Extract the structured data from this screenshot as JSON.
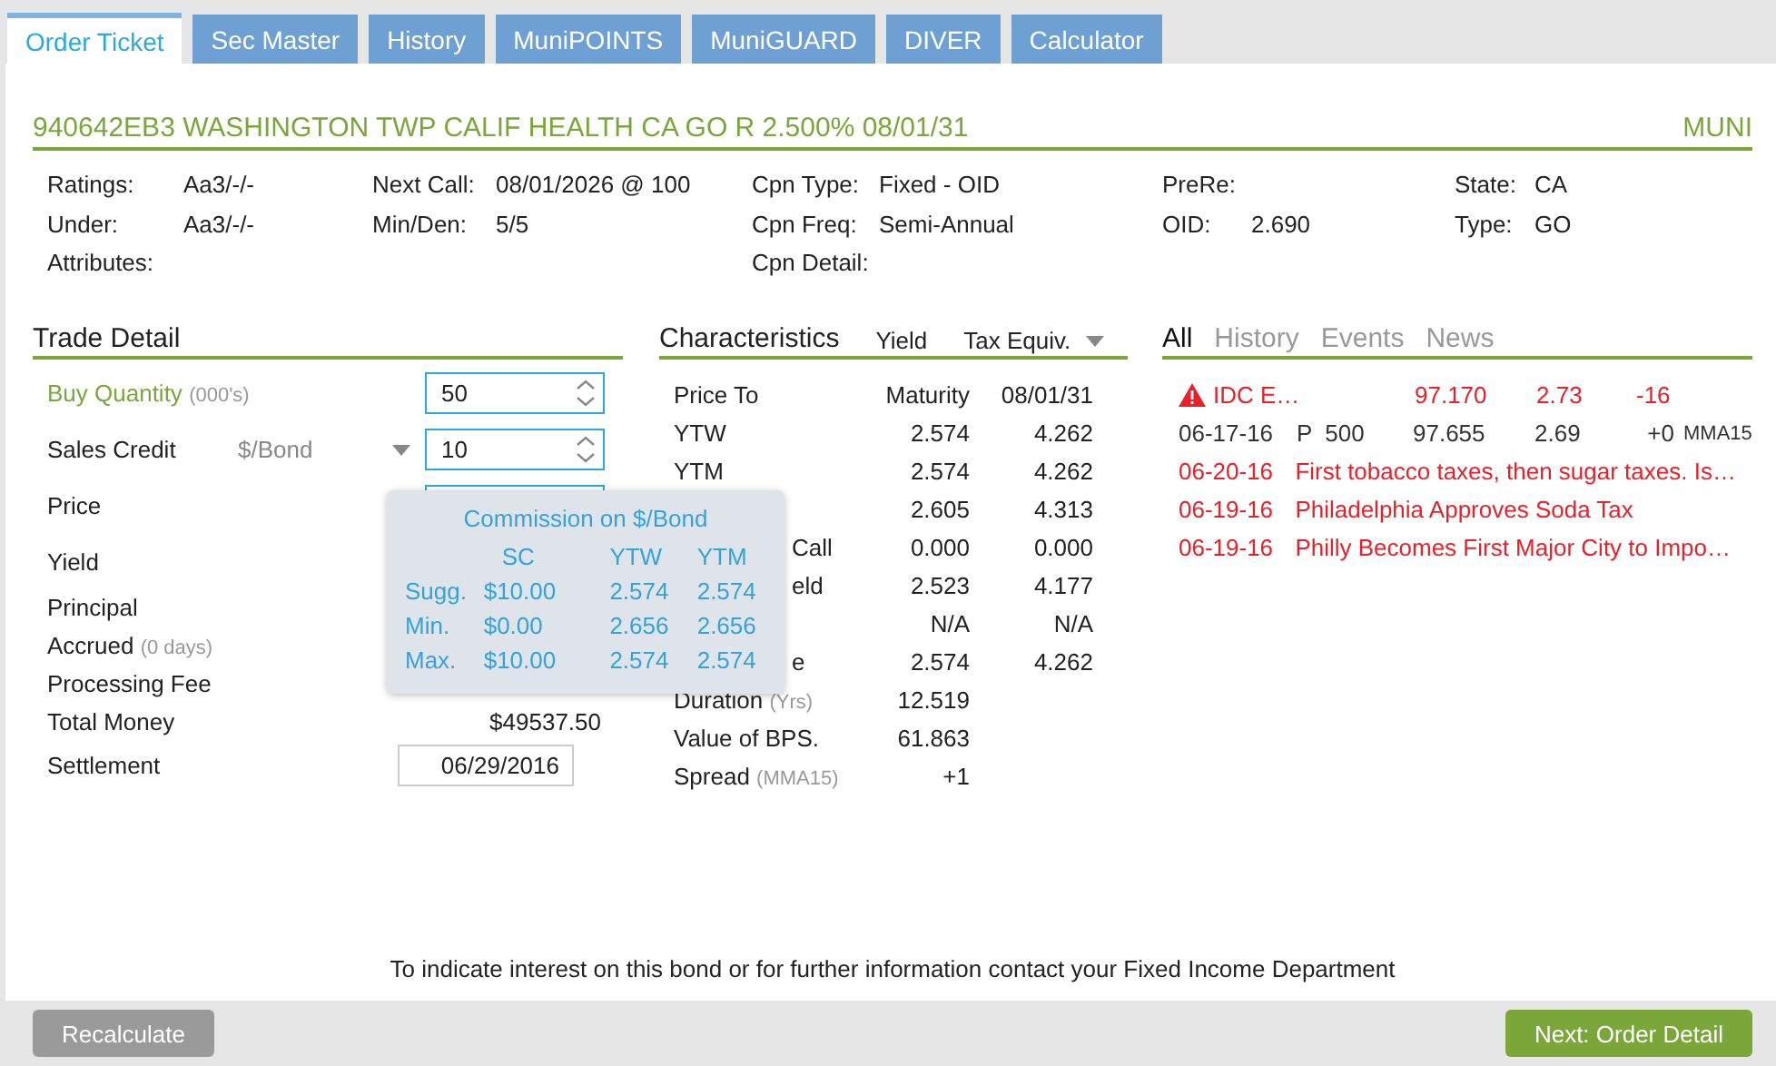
{
  "tabs": [
    {
      "label": "Order Ticket",
      "selected": true
    },
    {
      "label": "Sec Master",
      "selected": false
    },
    {
      "label": "History",
      "selected": false
    },
    {
      "label": "MuniPOINTS",
      "selected": false
    },
    {
      "label": "MuniGUARD",
      "selected": false
    },
    {
      "label": "DIVER",
      "selected": false
    },
    {
      "label": "Calculator",
      "selected": false
    }
  ],
  "security": {
    "title": "940642EB3 WASHINGTON TWP CALIF HEALTH CA GO R 2.500% 08/01/31",
    "type": "MUNI"
  },
  "info": [
    [
      {
        "label": "Ratings:",
        "value": "Aa3/-/-"
      },
      {
        "label": "Under:",
        "value": "Aa3/-/-"
      },
      {
        "label": "Attributes:"
      }
    ],
    [
      {
        "label": "Next Call:",
        "value": "08/01/2026 @ 100"
      },
      {
        "label": "Min/Den:",
        "value": "5/5"
      }
    ],
    [
      {
        "label": "Cpn Type:",
        "value": "Fixed - OID"
      },
      {
        "label": "Cpn Freq:",
        "value": "Semi-Annual"
      },
      {
        "label": "Cpn Detail:"
      }
    ],
    [
      {
        "label": "PreRe:"
      },
      {
        "label": "OID:",
        "value": "2.690"
      }
    ],
    [
      {
        "label": "State:",
        "value": "CA"
      },
      {
        "label": "Type:",
        "value": "GO"
      }
    ]
  ],
  "trade_detail": {
    "title": "Trade Detail",
    "rows": [
      {
        "kind": "spin",
        "label": "Buy Quantity",
        "note": "(000's)",
        "value": "50",
        "active": true
      },
      {
        "kind": "spin",
        "label": "Sales Credit",
        "unit": "$/Bond",
        "value": "10",
        "active": false
      },
      {
        "kind": "field",
        "label": "Price"
      },
      {
        "kind": "tall",
        "label": "Yield"
      },
      {
        "kind": "text",
        "label": "Principal"
      },
      {
        "kind": "text",
        "label": "Accrued",
        "note": "(0 days)"
      },
      {
        "kind": "text",
        "label": "Processing Fee"
      },
      {
        "kind": "text",
        "label": "Total Money",
        "value": "$49537.50"
      },
      {
        "kind": "date",
        "label": "Settlement",
        "value": "06/29/2016"
      }
    ]
  },
  "commission_popup": {
    "title": "Commission on $/Bond",
    "columns": [
      "SC",
      "YTW",
      "YTM"
    ],
    "rows": [
      {
        "label": "Sugg.",
        "values": [
          "$10.00",
          "2.574",
          "2.574"
        ]
      },
      {
        "label": "Min.",
        "values": [
          "$0.00",
          "2.656",
          "2.656"
        ]
      },
      {
        "label": "Max.",
        "values": [
          "$10.00",
          "2.574",
          "2.574"
        ]
      }
    ]
  },
  "characteristics": {
    "title": "Characteristics",
    "column_1": "Yield",
    "column_2": "Tax Equiv.",
    "rows": [
      {
        "kind": "plain",
        "label": "Price To",
        "values": [
          "Maturity",
          "08/01/31"
        ]
      },
      {
        "kind": "plain",
        "label": "YTW",
        "values": [
          "2.574",
          "4.262"
        ]
      },
      {
        "kind": "plain",
        "label": "YTM",
        "values": [
          "2.574",
          "4.262"
        ]
      },
      {
        "kind": "covered",
        "values": [
          "2.605",
          "4.313"
        ]
      },
      {
        "kind": "covered",
        "label": "Call",
        "values": [
          "0.000",
          "0.000"
        ]
      },
      {
        "kind": "covered",
        "label": "eld",
        "values": [
          "2.523",
          "4.177"
        ]
      },
      {
        "kind": "covered",
        "values": [
          "N/A",
          "N/A"
        ]
      },
      {
        "kind": "covered",
        "label": "e",
        "values": [
          "2.574",
          "4.262"
        ]
      },
      {
        "kind": "plain",
        "label": "Duration",
        "note": "(Yrs)",
        "values": [
          "12.519"
        ]
      },
      {
        "kind": "plain",
        "label": "Value of BPS.",
        "values": [
          "61.863"
        ]
      },
      {
        "kind": "plain",
        "label": "Spread",
        "note": "(MMA15)",
        "values": [
          "+1"
        ]
      }
    ]
  },
  "activity": {
    "tabs": [
      {
        "label": "All",
        "selected": true
      },
      {
        "label": "History",
        "selected": false
      },
      {
        "label": "Events",
        "selected": false
      },
      {
        "label": "News",
        "selected": false
      }
    ],
    "items": [
      {
        "kind": "alert",
        "cells": [
          "IDC E…",
          "97.170",
          "2.73",
          "-16"
        ]
      },
      {
        "kind": "trade",
        "cells": [
          "06-17-16",
          "P  500",
          "97.655",
          "2.69",
          "+0",
          "MMA15"
        ]
      },
      {
        "kind": "news",
        "cells": [
          "06-20-16",
          "First tobacco taxes, then sugar taxes. Is…"
        ]
      },
      {
        "kind": "news",
        "cells": [
          "06-19-16",
          "Philadelphia Approves Soda Tax"
        ]
      },
      {
        "kind": "news",
        "cells": [
          "06-19-16",
          "Philly Becomes First Major City to Impo…"
        ]
      }
    ]
  },
  "footer_note": "To indicate interest on this bond or for further information contact your Fixed Income Department",
  "buttons": [
    {
      "label": "Recalculate",
      "kind": "secondary"
    },
    {
      "label": "Next: Order Detail",
      "kind": "primary"
    }
  ]
}
